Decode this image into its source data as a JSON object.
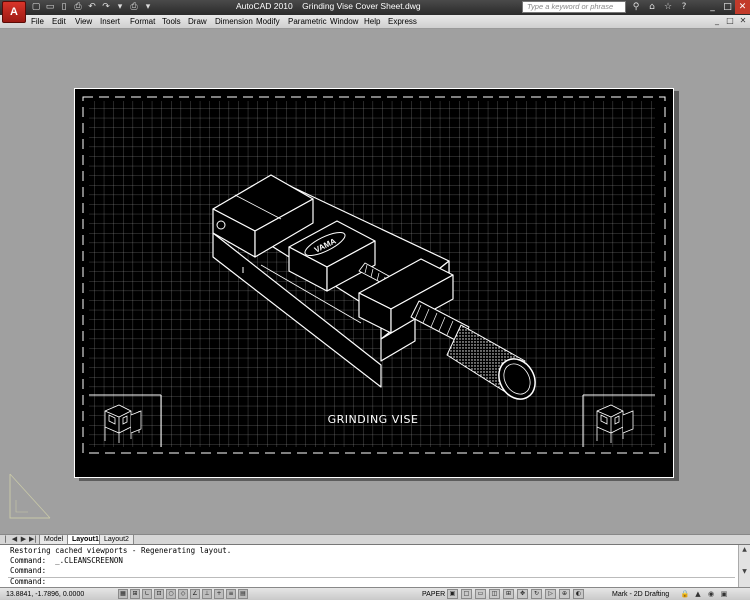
{
  "window": {
    "title": "AutoCAD 2010    Grinding Vise Cover Sheet.dwg",
    "logo_letter": "A",
    "search_placeholder": "Type a keyword or phrase",
    "controls": [
      "_",
      "□",
      "✕"
    ]
  },
  "quick_access": [
    "▢",
    "▭",
    "▯",
    "⎙",
    "↶",
    "↷",
    "▾",
    "⎙",
    "▾"
  ],
  "title_icons": [
    "⚲",
    "⌂",
    "☆",
    "?"
  ],
  "menu": {
    "items": [
      "File",
      "Edit",
      "View",
      "Insert",
      "Format",
      "Tools",
      "Draw",
      "Dimension",
      "Modify",
      "Parametric",
      "Window",
      "Help",
      "Express"
    ],
    "controls": [
      "_",
      "□",
      "✕"
    ]
  },
  "drawing": {
    "title_text": "GRINDING VISE",
    "vise_label": "VAMA",
    "accent_color": "#ffffff",
    "background_color": "#000000"
  },
  "tabs": {
    "nav": [
      "|◀",
      "◀",
      "▶",
      "▶|"
    ],
    "items": [
      "Model",
      "Layout1",
      "Layout2"
    ],
    "active": "Layout1"
  },
  "command": {
    "lines": [
      "Restoring cached viewports - Regenerating layout.",
      "Command:  _.CLEANSCREENON",
      "Command:",
      "Command:"
    ]
  },
  "status": {
    "coordinates": "13.8841, -1.7896, 0.0000",
    "space": "PAPER",
    "workspace": "Mark - 2D Drafting",
    "left_buttons": [
      "▦",
      "⊞",
      "∟",
      "⊡",
      "○",
      "◇",
      "∠",
      "⊥",
      "+",
      "≡",
      "▤"
    ],
    "right_buttons": [
      "▣",
      "□",
      "▭",
      "◫",
      "⊞",
      "✥",
      "↻",
      "▷",
      "⊕",
      "◐",
      "▲"
    ]
  }
}
